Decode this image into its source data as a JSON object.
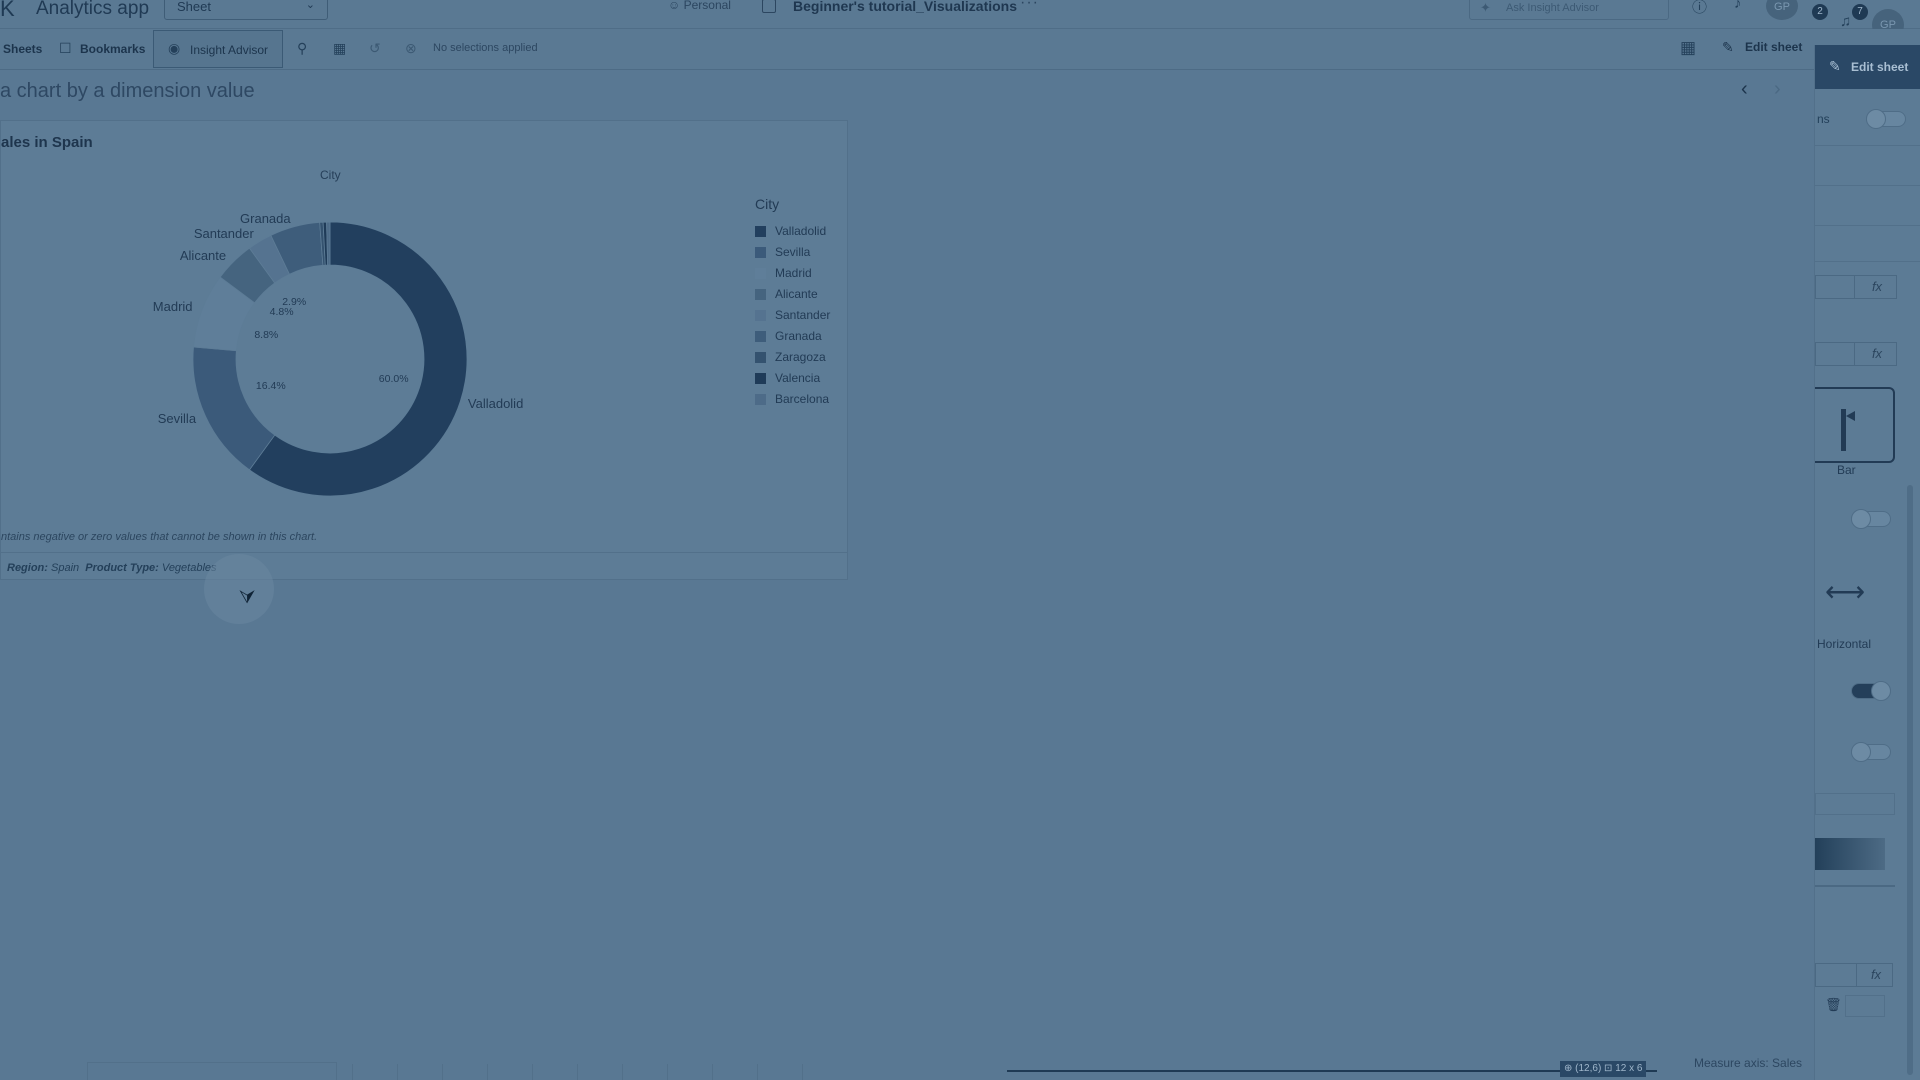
{
  "header": {
    "logo": "K",
    "app_title": "Analytics app",
    "sheet_dropdown": "Sheet",
    "space": "Personal",
    "document_title": "Beginner's tutorial_Visualizations",
    "more": "···",
    "search_placeholder": "Ask Insight Advisor",
    "badge_count_1": "2",
    "badge_count_2": "7",
    "avatar_initials": "GP"
  },
  "toolbar": {
    "sheets": "Sheets",
    "bookmarks": "Bookmarks",
    "insight_advisor": "Insight Advisor",
    "no_selections": "No selections applied",
    "edit_sheet": "Edit sheet"
  },
  "sheet": {
    "title": "a chart by a dimension value"
  },
  "card": {
    "title": "ales in Spain",
    "dimension_label": "City",
    "note": "ntains negative or zero values that cannot be shown in this chart.",
    "footer": {
      "region_label": "Region:",
      "region_value": "Spain",
      "product_label": "Product Type:",
      "product_value": "Vegetables"
    }
  },
  "chart_data": {
    "type": "pie",
    "subtype": "donut",
    "title": "ales in Spain",
    "dimension": "City",
    "legend_position": "right",
    "slices": [
      {
        "label": "Valladolid",
        "value": 60.0,
        "pct_label": "60.0%",
        "color": "#223f5e"
      },
      {
        "label": "Sevilla",
        "value": 16.4,
        "pct_label": "16.4%",
        "color": "#3b5a7a"
      },
      {
        "label": "Madrid",
        "value": 8.8,
        "pct_label": "8.8%",
        "color": "#5f7e99"
      },
      {
        "label": "Alicante",
        "value": 4.8,
        "pct_label": "4.8%",
        "color": "#45647f"
      },
      {
        "label": "Santander",
        "value": 2.9,
        "pct_label": "2.9%",
        "color": "#557390"
      },
      {
        "label": "Granada",
        "value": 5.9,
        "pct_label": "",
        "color": "#3e5d7b"
      },
      {
        "label": "Zaragoza",
        "value": 0.4,
        "pct_label": "",
        "color": "#34526f"
      },
      {
        "label": "Valencia",
        "value": 0.4,
        "pct_label": "",
        "color": "#1f3b58"
      },
      {
        "label": "Barcelona",
        "value": 0.4,
        "pct_label": "",
        "color": "#4d6b88"
      }
    ],
    "legend": [
      {
        "label": "Valladolid",
        "color": "#223f5e"
      },
      {
        "label": "Sevilla",
        "color": "#3b5a7a"
      },
      {
        "label": "Madrid",
        "color": "#5f7e99"
      },
      {
        "label": "Alicante",
        "color": "#45647f"
      },
      {
        "label": "Santander",
        "color": "#557390"
      },
      {
        "label": "Granada",
        "color": "#3e5d7b"
      },
      {
        "label": "Zaragoza",
        "color": "#34526f"
      },
      {
        "label": "Valencia",
        "color": "#1f3b58"
      },
      {
        "label": "Barcelona",
        "color": "#4d6b88"
      }
    ]
  },
  "right_panel": {
    "edit_sheet": "Edit sheet",
    "truncated_label": "ns",
    "fx": "fx",
    "bar_label": "Bar",
    "horizontal_label": "Horizontal"
  },
  "bottom": {
    "coords": "⊕ (12,6) ⊡ 12 x 6",
    "measure_axis": "Measure axis: Sales"
  }
}
